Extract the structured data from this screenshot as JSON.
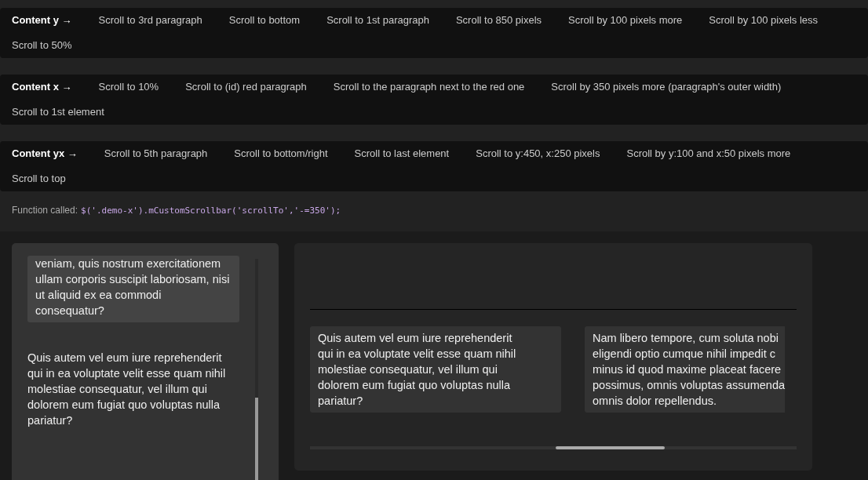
{
  "control_bars": [
    {
      "title": "Content y →",
      "buttons": [
        "Scroll to 3rd paragraph",
        "Scroll to bottom",
        "Scroll to 1st paragraph",
        "Scroll to 850 pixels",
        "Scroll by 100 pixels more",
        "Scroll by 100 pixels less",
        "Scroll to 50%"
      ]
    },
    {
      "title": "Content x →",
      "buttons": [
        "Scroll to 10%",
        "Scroll to (id) red paragraph",
        "Scroll to the paragraph next to the red one",
        "Scroll by 350 pixels more (paragraph's outer width)",
        "Scroll to 1st element"
      ]
    },
    {
      "title": "Content yx →",
      "buttons": [
        "Scroll to 5th paragraph",
        "Scroll to bottom/right",
        "Scroll to last element",
        "Scroll to y:450, x:250 pixels",
        "Scroll by y:100 and x:50 pixels more",
        "Scroll to top"
      ]
    }
  ],
  "function_called": {
    "label": "Function called:",
    "code": "$('.demo-x').mCustomScrollbar('scrollTo','-=350');"
  },
  "vertical_demo": {
    "paragraphs": [
      {
        "text": "veniam, quis nostrum exercitationem ullam corporis suscipit laboriosam, nisi ut aliquid ex ea commodi consequatur?",
        "highlighted": true
      },
      {
        "text": "Quis autem vel eum iure reprehenderit qui in ea voluptate velit esse quam nihil molestiae consequatur, vel illum qui dolorem eum fugiat quo voluptas nulla pariatur?",
        "highlighted": false
      }
    ]
  },
  "horizontal_demo": {
    "paragraphs": [
      {
        "text": "Quis autem vel eum iure reprehenderit\nqui in ea voluptate velit esse quam nihil\nmolestiae consequatur, vel illum qui\ndolorem eum fugiat quo voluptas nulla\npariatur?"
      },
      {
        "text": "Nam libero tempore, cum soluta nobi\neligendi optio cumque nihil impedit c\nminus id quod maxime placeat facere\npossimus, omnis voluptas assumenda\nomnis dolor repellendus."
      }
    ]
  }
}
